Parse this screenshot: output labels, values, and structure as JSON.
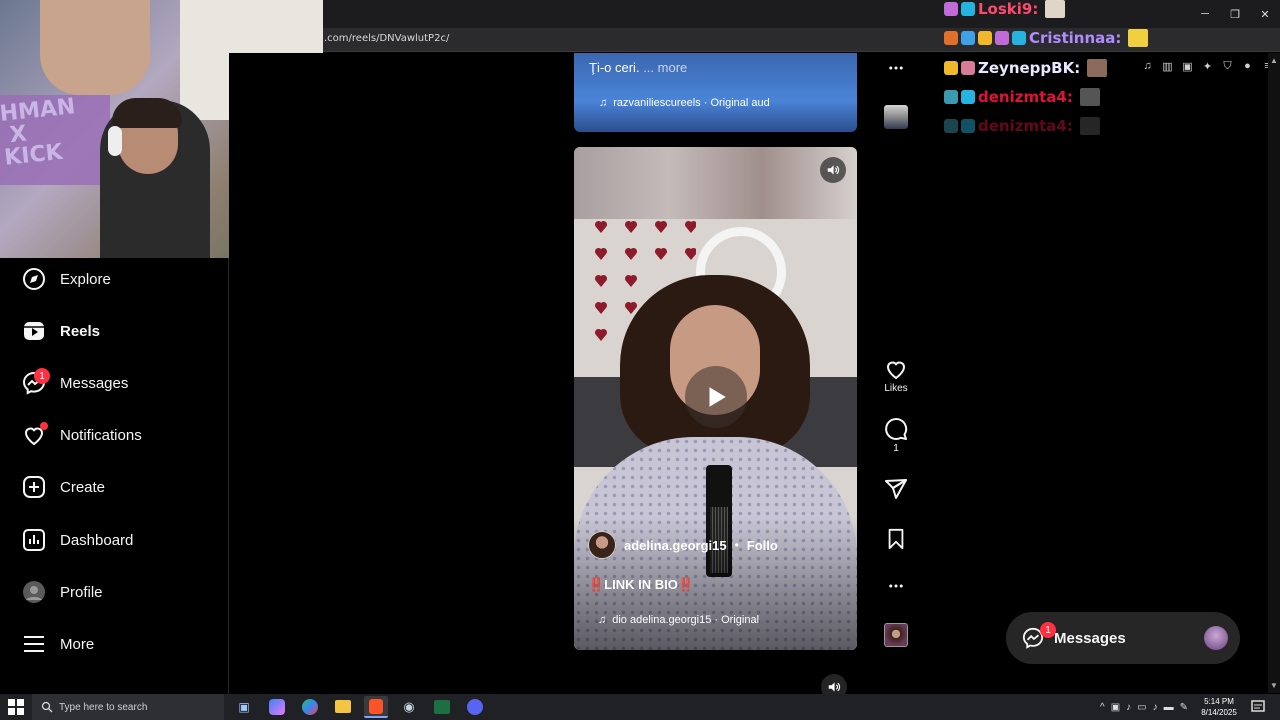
{
  "browser": {
    "url": ".com/reels/DNVawlutP2c/"
  },
  "webcam": {
    "banner_text": "HMAN\nX\nKICK"
  },
  "sidenav": {
    "items": [
      {
        "label": "Explore",
        "icon": "compass-icon"
      },
      {
        "label": "Reels",
        "icon": "reels-icon",
        "active": true
      },
      {
        "label": "Messages",
        "icon": "messenger-icon",
        "badge": "1"
      },
      {
        "label": "Notifications",
        "icon": "heart-icon",
        "dot": true
      },
      {
        "label": "Create",
        "icon": "plus-square-icon"
      },
      {
        "label": "Dashboard",
        "icon": "dashboard-icon"
      },
      {
        "label": "Profile",
        "icon": "avatar"
      },
      {
        "label": "More",
        "icon": "hamburger-icon"
      }
    ]
  },
  "reel_top": {
    "caption": "Ţi-o ceri.",
    "more": "... more",
    "audio": "razvaniliescureels · Original aud"
  },
  "reel_main": {
    "author": "adelina.georgi15",
    "separator": "•",
    "follow": "Follo",
    "caption": "‼️LINK IN BIO‼️",
    "audio": "dio  adelina.georgi15 · Original"
  },
  "actions": {
    "likes_label": "Likes",
    "comments_count": "1"
  },
  "chat": [
    {
      "user": "Loski9:",
      "color": "#ff4a6e"
    },
    {
      "user": "Cristinnaa:",
      "color": "#b08cff"
    },
    {
      "user": "ZeyneppBK:",
      "color": "#e8e8ff"
    },
    {
      "user": "denizmta4:",
      "color": "#e0113a"
    },
    {
      "user": "denizmta4:",
      "color": "#8a1028"
    }
  ],
  "messages_pill": {
    "label": "Messages",
    "badge": "1"
  },
  "taskbar": {
    "search_placeholder": "Type here to search",
    "time": "5:14 PM",
    "date": "8/14/2025"
  },
  "colors": {
    "badge": "#ff3040",
    "background": "#000000",
    "pill": "#262626"
  }
}
